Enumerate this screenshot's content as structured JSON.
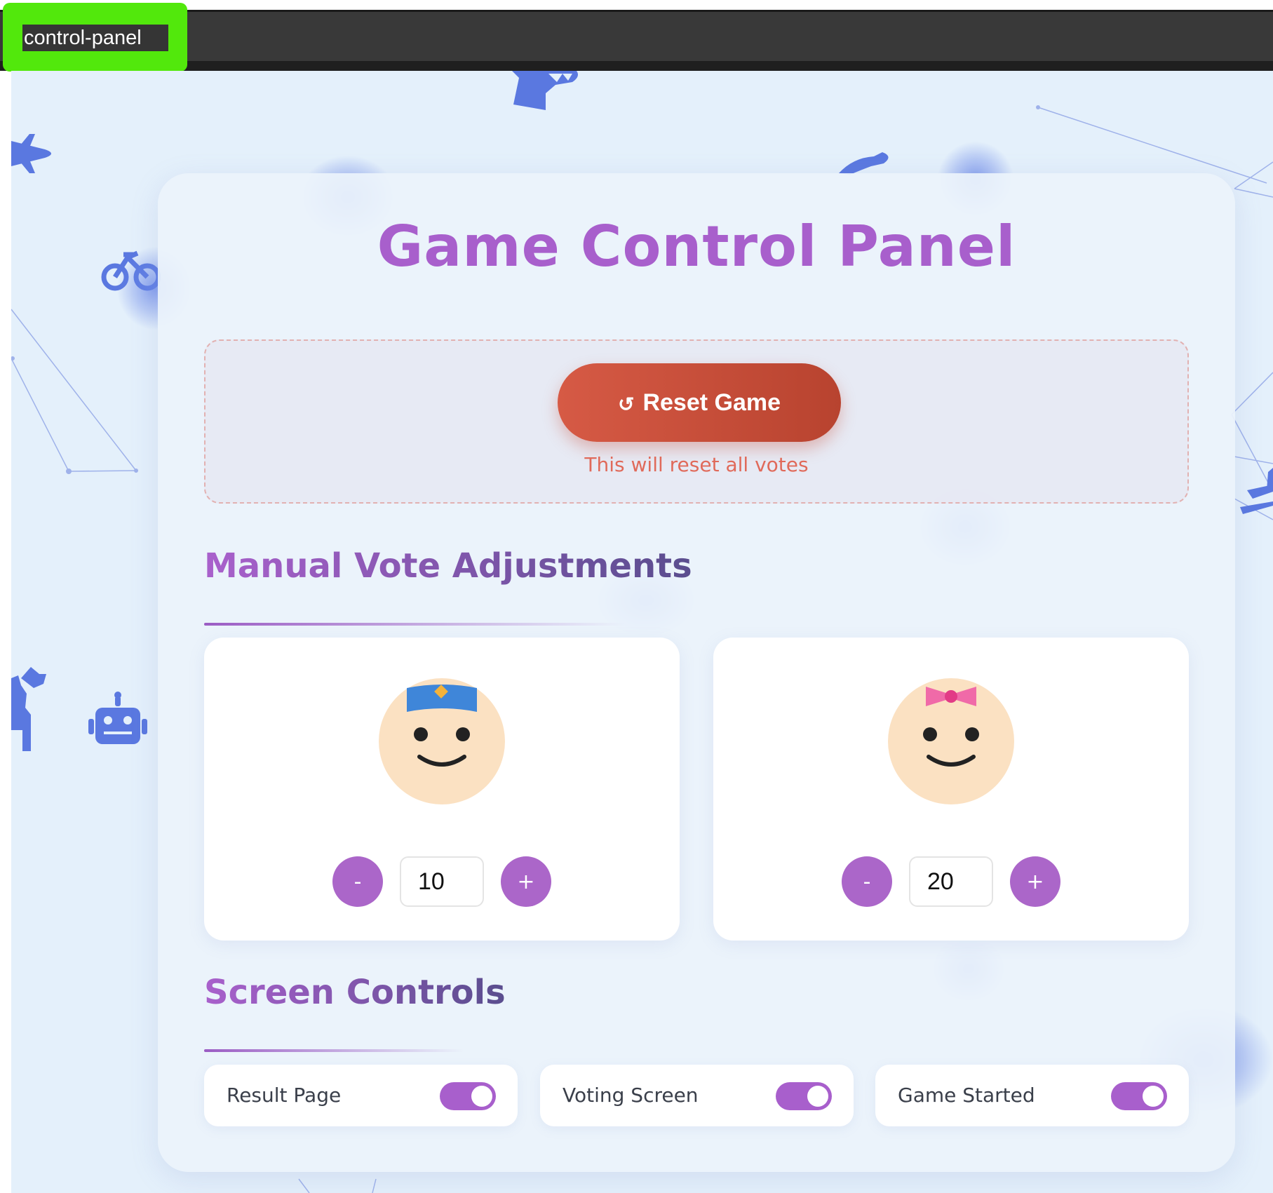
{
  "tab": {
    "title": "control-panel"
  },
  "panel": {
    "title": "Game Control Panel"
  },
  "reset": {
    "button_label": "Reset Game",
    "icon": "↺",
    "note": "This will reset all votes"
  },
  "manual_votes": {
    "title": "Manual Vote Adjustments",
    "candidates": [
      {
        "avatar": "boy-avatar-icon",
        "minus_label": "-",
        "plus_label": "+",
        "value": "10"
      },
      {
        "avatar": "girl-avatar-icon",
        "minus_label": "-",
        "plus_label": "+",
        "value": "20"
      }
    ]
  },
  "screen_controls": {
    "title": "Screen Controls",
    "toggles": [
      {
        "label": "Result Page",
        "on": true
      },
      {
        "label": "Voting Screen",
        "on": true
      },
      {
        "label": "Game Started",
        "on": true
      }
    ]
  },
  "colors": {
    "accent": "#a85fcc",
    "reset": "#c94e3a",
    "background": "#e4f0fb",
    "decor": "#5a78e0"
  }
}
